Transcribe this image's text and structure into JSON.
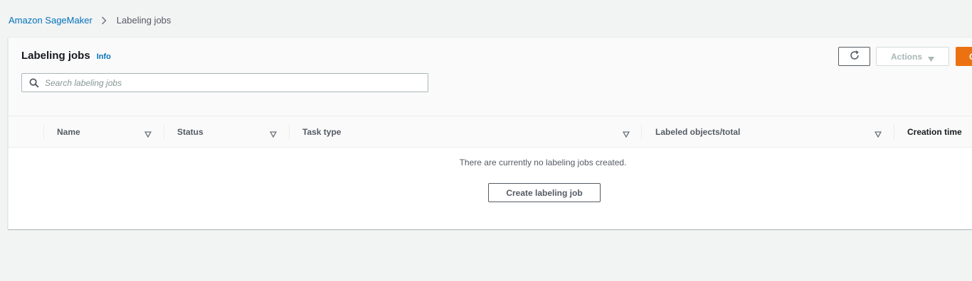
{
  "breadcrumb": {
    "root": "Amazon SageMaker",
    "current": "Labeling jobs"
  },
  "panel": {
    "title": "Labeling jobs",
    "info_label": "Info",
    "search_placeholder": "Search labeling jobs",
    "actions_label": "Actions",
    "create_top_label": "C"
  },
  "table": {
    "columns": [
      "Name",
      "Status",
      "Task type",
      "Labeled objects/total",
      "Creation time"
    ],
    "empty_message": "There are currently no labeling jobs created.",
    "create_button_label": "Create labeling job"
  },
  "colors": {
    "link": "#0073bb",
    "primary_button": "#ec7211",
    "background": "#f2f3f3"
  },
  "icons": [
    "chevron-right-icon",
    "search-icon",
    "refresh-icon",
    "caret-down-icon",
    "sort-icon"
  ]
}
